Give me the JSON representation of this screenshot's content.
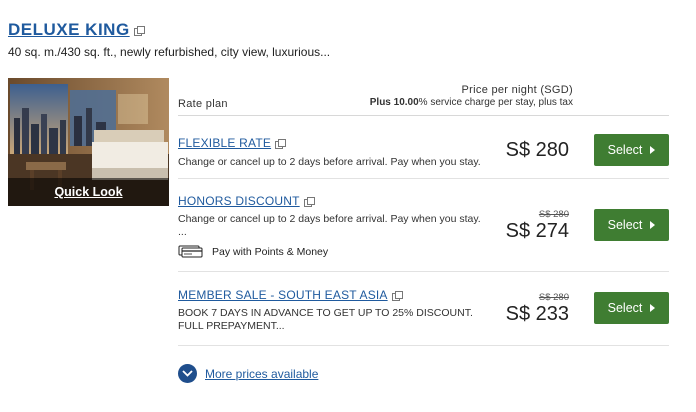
{
  "room": {
    "title": "DELUXE KING",
    "description": "40 sq. m./430 sq. ft., newly refurbished, city view, luxurious..."
  },
  "photo": {
    "quick_look": "Quick Look"
  },
  "header": {
    "rate_plan": "Rate plan",
    "price_per_night": "Price per night (SGD)",
    "service_charge_bold": "Plus 10.00",
    "service_charge_rest": "% service charge per stay, plus tax"
  },
  "rates": [
    {
      "name": "FLEXIBLE RATE",
      "description": "Change or cancel up to 2 days before arrival. Pay when you stay.",
      "original_price": "",
      "price": "S$ 280",
      "button": "Select"
    },
    {
      "name": "HONORS DISCOUNT",
      "description": "Change or cancel up to 2 days before arrival. Pay when you stay.",
      "description_more": "...",
      "points": "Pay with Points & Money",
      "original_price": "S$ 280",
      "price": "S$ 274",
      "button": "Select"
    },
    {
      "name": "MEMBER SALE - SOUTH EAST ASIA",
      "description_line1": "BOOK 7 DAYS IN ADVANCE TO GET UP TO 25% DISCOUNT.",
      "description_line2": "FULL PREPAYMENT...",
      "original_price": "S$ 280",
      "price": "S$ 233",
      "button": "Select"
    }
  ],
  "more_prices": "More prices available",
  "colors": {
    "link": "#1f5a9e",
    "select_button": "#3f7d32",
    "more_circle": "#1f4e8c"
  },
  "icons": {
    "external_link": "external-link-icon",
    "caret": "caret-right-icon",
    "points": "points-cards-icon",
    "chevron": "chevron-down-icon"
  }
}
